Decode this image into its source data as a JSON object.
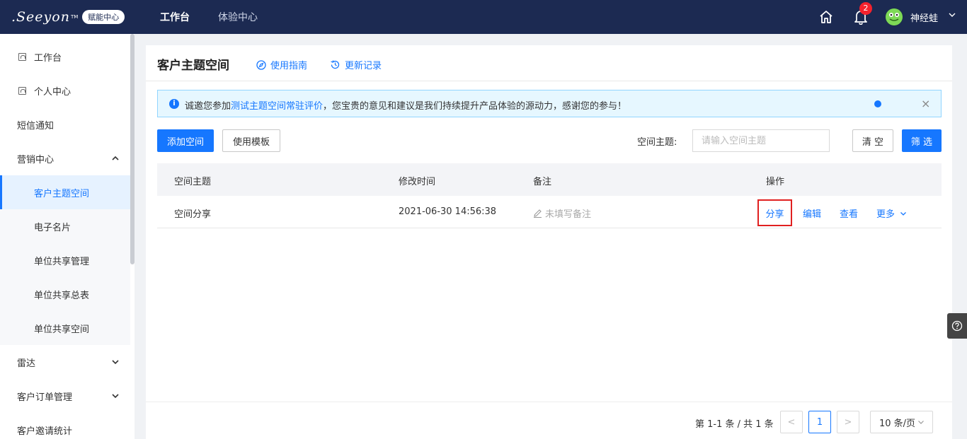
{
  "brand": {
    "logo_text": ".Seeyon",
    "logo_tm": "TM",
    "badge": "赋能中心"
  },
  "topnav": [
    {
      "label": "工作台",
      "active": true
    },
    {
      "label": "体验中心",
      "active": false
    }
  ],
  "user": {
    "name": "神经蛙",
    "notifications": "2"
  },
  "sidebar": {
    "items": [
      {
        "label": "工作台"
      },
      {
        "label": "个人中心"
      },
      {
        "label": "短信通知"
      },
      {
        "label": "营销中心"
      },
      {
        "label": "客户主题空间"
      },
      {
        "label": "电子名片"
      },
      {
        "label": "单位共享管理"
      },
      {
        "label": "单位共享总表"
      },
      {
        "label": "单位共享空间"
      },
      {
        "label": "雷达"
      },
      {
        "label": "客户订单管理"
      },
      {
        "label": "客户邀请统计"
      }
    ]
  },
  "page": {
    "title": "客户主题空间",
    "guide_link": "使用指南",
    "changelog_link": "更新记录"
  },
  "notice": {
    "prefix": "诚邀您参加",
    "link": "测试主题空间常驻评价",
    "suffix": "，您宝贵的意见和建议是我们持续提升产品体验的源动力，感谢您的参与！",
    "close": "×"
  },
  "toolbar": {
    "add_label": "添加空间",
    "template_label": "使用模板",
    "filter_label": "空间主题:",
    "filter_placeholder": "请输入空间主题",
    "clear_label": "清 空",
    "filter_button": "筛 选"
  },
  "table": {
    "columns": [
      "空间主题",
      "修改时间",
      "备注",
      "操作"
    ],
    "rows": [
      {
        "topic": "空间分享",
        "modified": "2021-06-30 14:56:38",
        "remark": "未填写备注",
        "actions": {
          "share": "分享",
          "edit": "编辑",
          "view": "查看",
          "more": "更多"
        }
      }
    ]
  },
  "pagination": {
    "info": "第 1-1 条 / 共 1 条",
    "prev": "<",
    "current": "1",
    "next": ">",
    "page_size": "10 条/页"
  },
  "colors": {
    "primary": "#1677ff",
    "topbar": "#1c2a52",
    "highlight_border": "#e02020"
  }
}
